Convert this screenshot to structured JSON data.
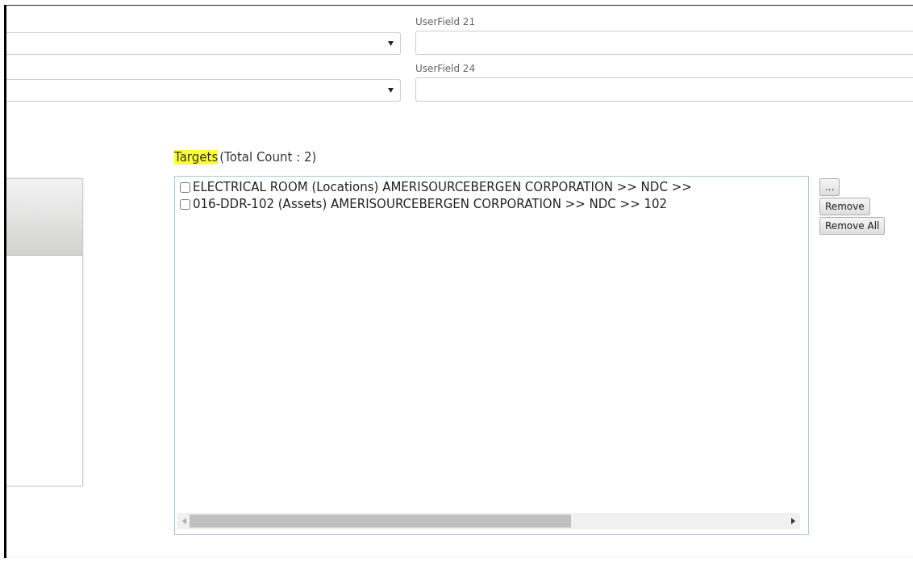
{
  "form_rows": [
    {
      "label": "UserField 21"
    },
    {
      "label": "UserField 24"
    }
  ],
  "targets": {
    "title": "Targets",
    "highlighted": true,
    "count": "(Total Count : 2)",
    "items": [
      {
        "text": "ELECTRICAL ROOM (Locations) AMERISOURCEBERGEN CORPORATION >> NDC >>",
        "checked": false
      },
      {
        "text": "016-DDR-102 (Assets) AMERISOURCEBERGEN CORPORATION >> NDC >> 102",
        "checked": false
      }
    ],
    "buttons": [
      "...",
      "Remove",
      "Remove All"
    ]
  }
}
